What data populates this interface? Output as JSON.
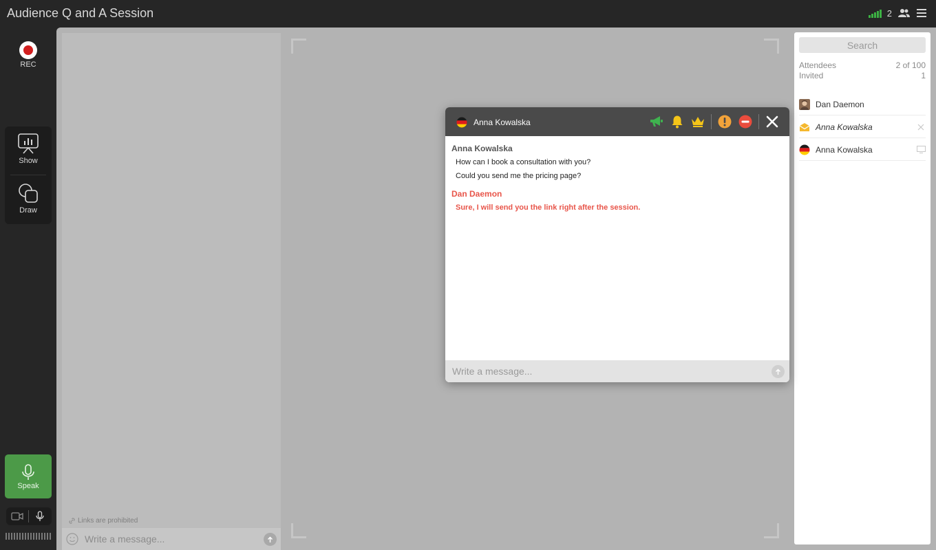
{
  "app": {
    "title": "Audience Q and A Session"
  },
  "topbar": {
    "participant_count": "2",
    "icons": [
      "signal-icon",
      "users-icon",
      "menu-icon"
    ],
    "signal_color": "#3cb043"
  },
  "rail": {
    "rec_label": "REC",
    "show_label": "Show",
    "draw_label": "Draw",
    "speak_label": "Speak",
    "speak_color": "#4c9a48"
  },
  "left_chat": {
    "links_note": "Links are prohibited",
    "placeholder": "Write a message..."
  },
  "sidebar": {
    "search_placeholder": "Search",
    "attendees_label": "Attendees",
    "attendees_value": "2 of 100",
    "invited_label": "Invited",
    "invited_value": "1",
    "people": [
      {
        "name": "Dan Daemon",
        "icon": "avatar-photo"
      },
      {
        "name": "Anna Kowalska",
        "icon": "envelope-icon",
        "trail_icon": "close-icon"
      },
      {
        "name": "Anna Kowalska",
        "icon": "germany-flag-icon",
        "trail_icon": "screen-icon"
      }
    ]
  },
  "dialog": {
    "title": "Anna Kowalska",
    "title_icon": "germany-flag-icon",
    "actions": [
      "megaphone-icon",
      "bell-icon",
      "crown-icon",
      "warning-icon",
      "block-icon",
      "close-icon"
    ],
    "messages": [
      {
        "author": "Anna Kowalska",
        "lines": [
          "How can I book a consultation with you?",
          "Could you send me the pricing page?"
        ]
      },
      {
        "author": "Dan Daemon",
        "lines": [
          "Sure, I will send you the link right after the session."
        ],
        "accent": "#e8554a"
      }
    ],
    "placeholder": "Write a message..."
  }
}
